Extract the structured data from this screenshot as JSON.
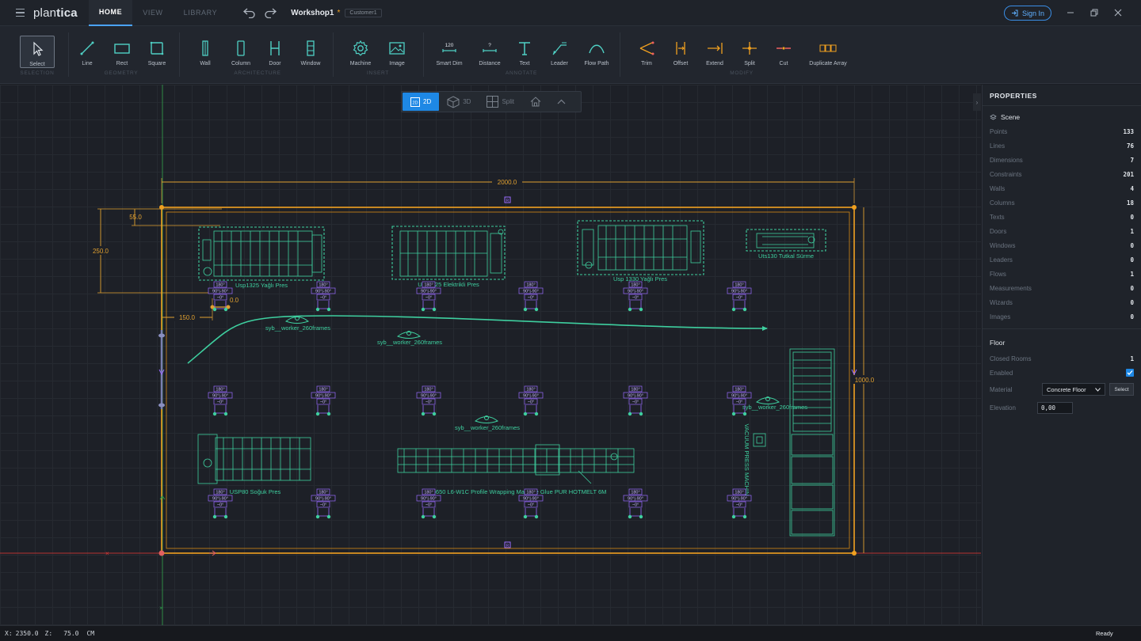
{
  "app": {
    "logo_light": "plan",
    "logo_bold": "tica"
  },
  "menu_tabs": [
    "HOME",
    "VIEW",
    "LIBRARY"
  ],
  "document": {
    "title": "Workshop1",
    "dirty_marker": "*",
    "chip": "Customer1"
  },
  "account": {
    "sign_in_label": "Sign In"
  },
  "ribbon": {
    "tools": [
      {
        "label": "Select",
        "icon": "cursor-icon"
      },
      {
        "label": "Line",
        "icon": "line-icon"
      },
      {
        "label": "Rect",
        "icon": "rect-icon"
      },
      {
        "label": "Square",
        "icon": "square-icon"
      },
      {
        "label": "Wall",
        "icon": "wall-icon"
      },
      {
        "label": "Column",
        "icon": "column-icon"
      },
      {
        "label": "Door",
        "icon": "door-icon"
      },
      {
        "label": "Window",
        "icon": "window-icon"
      },
      {
        "label": "Machine",
        "icon": "gear-icon"
      },
      {
        "label": "Image",
        "icon": "image-icon"
      },
      {
        "label": "Smart Dim",
        "icon": "smart-dim-icon",
        "badge": "120"
      },
      {
        "label": "Distance",
        "icon": "distance-icon",
        "badge": "?"
      },
      {
        "label": "Text",
        "icon": "text-icon"
      },
      {
        "label": "Leader",
        "icon": "leader-icon"
      },
      {
        "label": "Flow Path",
        "icon": "flow-path-icon"
      },
      {
        "label": "Trim",
        "icon": "trim-icon"
      },
      {
        "label": "Offset",
        "icon": "offset-icon"
      },
      {
        "label": "Extend",
        "icon": "extend-icon"
      },
      {
        "label": "Split",
        "icon": "split-icon"
      },
      {
        "label": "Cut",
        "icon": "cut-icon"
      },
      {
        "label": "Duplicate Array",
        "icon": "duplicate-array-icon"
      }
    ],
    "groups": [
      "SELECTION",
      "GEOMETRY",
      "ARCHITECTURE",
      "INSERT",
      "ANNOTATE",
      "MODIFY"
    ]
  },
  "view_toolbar": {
    "mode_2d": "2D",
    "mode_2d_badge": "2D",
    "mode_3d": "3D",
    "mode_split": "Split"
  },
  "canvas": {
    "dimensions": {
      "width": "2000.0",
      "height": "1000.0",
      "left_250": "250.0",
      "left_55": "55.0",
      "offset_150": "150.0",
      "origin_zero": "0.0"
    },
    "machines": [
      "Usp1325 Yağlı Pres",
      "Usp1325 Elektrikli Pres",
      "Usp 1330 Yağlı Pres",
      "Uts130 Tutkal Sürme",
      "USP80 Soğuk Pres",
      "Usp650 L6-W1C Profile Wrapping Machine Glue PUR HOTMELT 6M",
      "VACUUM PRESS MACHIN"
    ],
    "workers": [
      "syb__worker_260frames",
      "syb__worker_260frames",
      "syb__worker_260frames",
      "syb__worker_260frames"
    ],
    "column_tag": {
      "top": "180°",
      "mid": "90°|-90°",
      "bottom": "~0°"
    },
    "marker_letter": "R"
  },
  "properties": {
    "title": "PROPERTIES",
    "scene_label": "Scene",
    "scene_rows": [
      {
        "k": "Points",
        "v": "133"
      },
      {
        "k": "Lines",
        "v": "76"
      },
      {
        "k": "Dimensions",
        "v": "7"
      },
      {
        "k": "Constraints",
        "v": "201"
      },
      {
        "k": "Walls",
        "v": "4"
      },
      {
        "k": "Columns",
        "v": "18"
      },
      {
        "k": "Texts",
        "v": "0"
      },
      {
        "k": "Doors",
        "v": "1"
      },
      {
        "k": "Windows",
        "v": "0"
      },
      {
        "k": "Leaders",
        "v": "0"
      },
      {
        "k": "Flows",
        "v": "1"
      },
      {
        "k": "Measurements",
        "v": "0"
      },
      {
        "k": "Wizards",
        "v": "0"
      },
      {
        "k": "Images",
        "v": "0"
      }
    ],
    "floor_label": "Floor",
    "closed_rooms_label": "Closed Rooms",
    "closed_rooms_value": "1",
    "enabled_label": "Enabled",
    "enabled": true,
    "material_label": "Material",
    "material_value": "Concrete Floor",
    "select_label": "Select",
    "elevation_label": "Elevation",
    "elevation_value": "0,00"
  },
  "status": {
    "x_label": "X:",
    "x_value": "2350.0",
    "z_label": "Z:",
    "z_value": "75.0",
    "unit": "CM",
    "state": "Ready"
  },
  "colors": {
    "accent": "#1e88e5",
    "wall": "#f0a020",
    "machine": "#3ecf9f",
    "tag": "#9a6cff",
    "axis_x": "#d23a3a",
    "axis_y": "#2e9a4a"
  }
}
